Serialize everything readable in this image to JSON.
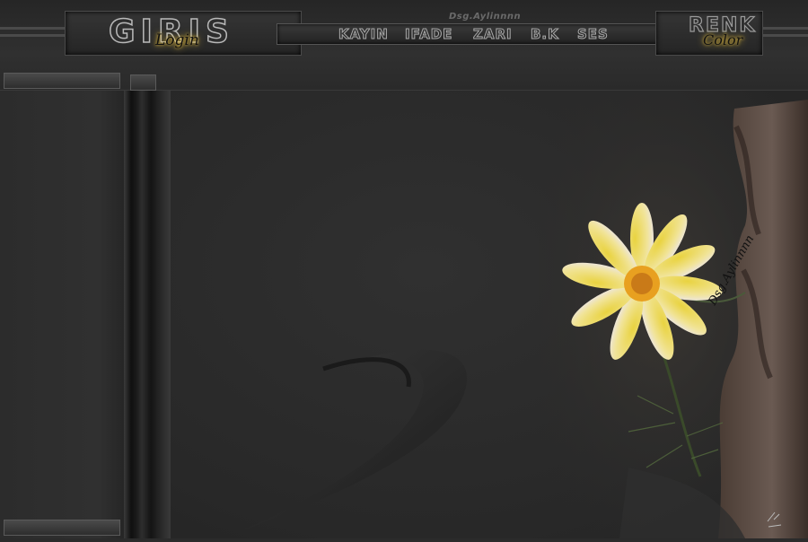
{
  "header": {
    "login_title": "GIRIS",
    "login_subtitle": "Login",
    "brand": "Dsg.Aylinnnn",
    "nav": [
      {
        "label": "KAYIN"
      },
      {
        "label": "IFADE"
      },
      {
        "label": "ZARI"
      },
      {
        "label": "B.K"
      },
      {
        "label": "SES"
      }
    ],
    "color_title": "RENK",
    "color_subtitle": "Color"
  },
  "watermark": "Dsg.Aylinnnn",
  "colors": {
    "background": "#2b2b2b",
    "accent_glow": "#e8c040",
    "flower_petal": "#f1e49a",
    "flower_center": "#e8a020"
  }
}
